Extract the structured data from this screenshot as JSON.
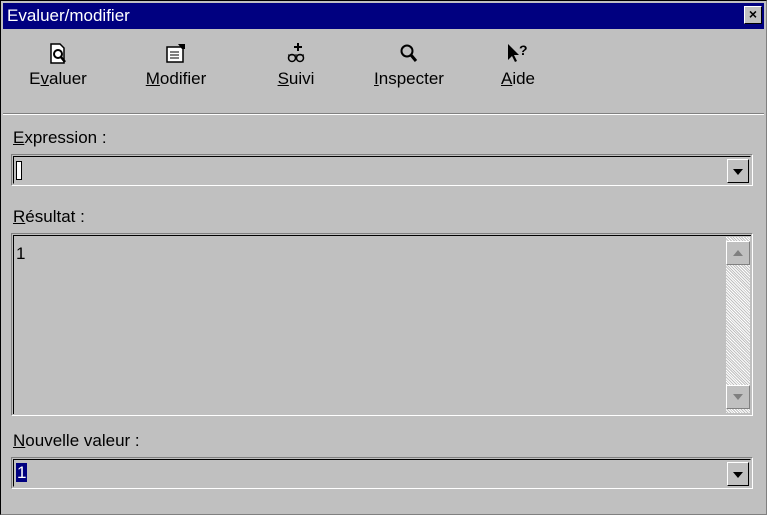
{
  "window": {
    "title": "Evaluer/modifier",
    "close_glyph": "×"
  },
  "toolbar": {
    "items": [
      {
        "pre": "E",
        "u": "v",
        "post": "aluer",
        "icon": "evaluate-icon"
      },
      {
        "pre": "",
        "u": "M",
        "post": "odifier",
        "icon": "modify-icon"
      },
      {
        "pre": "",
        "u": "S",
        "post": "uivi",
        "icon": "watch-icon"
      },
      {
        "pre": "",
        "u": "I",
        "post": "nspecter",
        "icon": "inspect-icon"
      },
      {
        "pre": "",
        "u": "A",
        "post": "ide",
        "icon": "help-icon"
      }
    ]
  },
  "expression": {
    "label_u": "E",
    "label_rest": "xpression :",
    "value": ""
  },
  "result": {
    "label_u": "R",
    "label_rest": "ésultat :",
    "value": "1"
  },
  "new_value": {
    "label_u": "N",
    "label_rest": "ouvelle valeur :",
    "value": "1"
  },
  "colors": {
    "titlebar": "#000080",
    "face": "#c0c0c0",
    "selection": "#000080"
  }
}
